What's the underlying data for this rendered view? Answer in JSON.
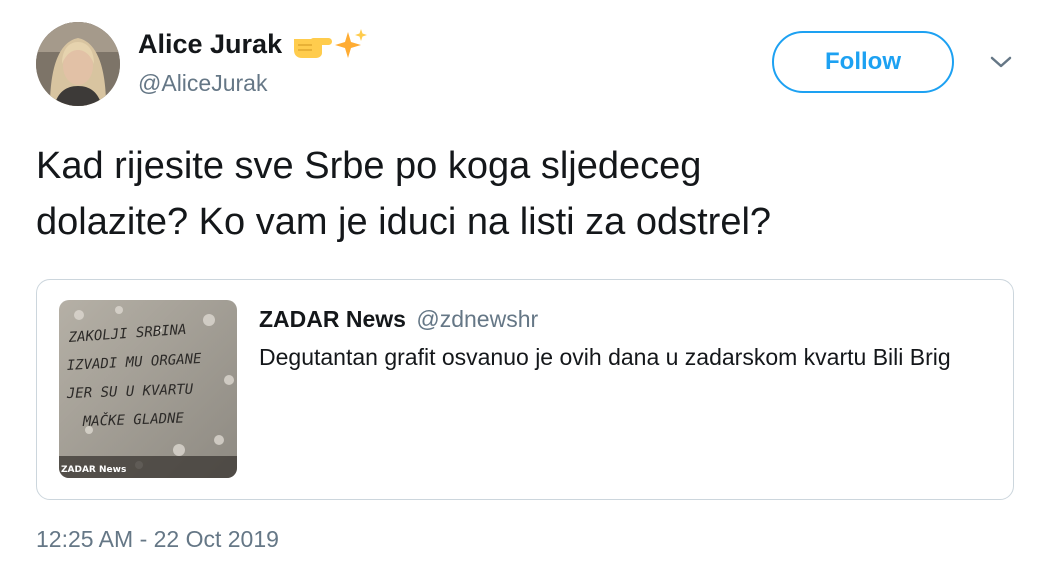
{
  "author": {
    "display_name": "Alice Jurak",
    "handle": "@AliceJurak",
    "name_emojis": [
      "backhand-index-pointing-right-emoji",
      "sparkles-emoji"
    ]
  },
  "actions": {
    "follow_label": "Follow",
    "menu_icon": "chevron-down-icon"
  },
  "tweet": {
    "text": "Kad rijesite sve Srbe po koga sljedeceg\ndolazite? Ko vam je iduci na listi za odstrel?",
    "timestamp": "12:25 AM - 22 Oct 2019"
  },
  "quoted": {
    "display_name": "ZADAR News",
    "handle": "@zdnewshr",
    "text": "Degutantan grafit osvanuo je ovih dana u zadarskom kvartu Bili Brig",
    "image": {
      "graffiti_lines": [
        "ZAKOLJI SRBINA",
        "IZVADI MU ORGANE",
        "JER SU U KVARTU",
        "MAČKE GLADNE"
      ],
      "watermark": "ZADAR News"
    }
  },
  "colors": {
    "accent": "#1da1f2",
    "text": "#14171a",
    "secondary": "#657786",
    "border": "#ccd6dd"
  }
}
